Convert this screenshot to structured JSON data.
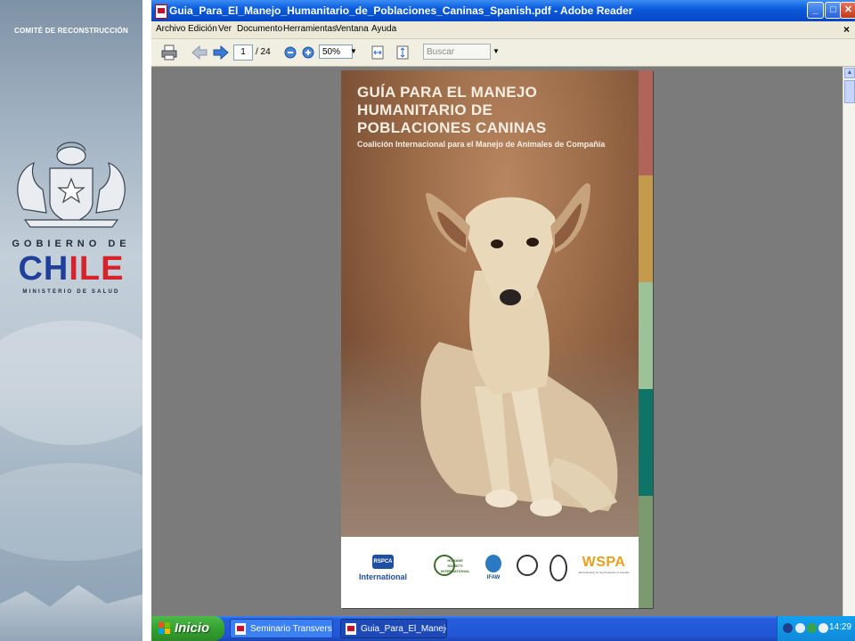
{
  "banner": {
    "committee": "COMITÉ DE RECONSTRUCCIÓN",
    "gobierno": "GOBIERNO DE",
    "chile_part1": "CH",
    "chile_part2": "ILE",
    "ministerio": "MINISTERIO DE SALUD"
  },
  "window": {
    "title": "Guia_Para_El_Manejo_Humanitario_de_Poblaciones_Caninas_Spanish.pdf - Adobe Reader",
    "minimize": "_",
    "maximize": "□",
    "close": "✕",
    "menu": [
      "Archivo",
      "Edición",
      "Ver",
      "Documento",
      "Herramientas",
      "Ventana",
      "Ayuda"
    ],
    "menu_close": "×"
  },
  "toolbar": {
    "current_page": "1",
    "total_pages": "/ 24",
    "zoom": "50%",
    "search_placeholder": "Buscar",
    "dropdown_glyph": "▼"
  },
  "document": {
    "title_line1": "GUÍA PARA EL MANEJO",
    "title_line2": "HUMANITARIO DE",
    "title_line3": "POBLACIONES CANINAS",
    "subtitle": "Coalición Internacional para el Manejo de Animales de Compañía",
    "stripe_colors": [
      "#b0645a",
      "#c49a4c",
      "#9dc198",
      "#0f7468",
      "#7c9a70"
    ],
    "logos": {
      "rspca_badge": "RSPCA",
      "rspca_text": "International",
      "hsi_text": "HUMANE SOCIETY INTERNATIONAL",
      "ifaw_text": "IFAW",
      "wspa_text": "WSPA",
      "wspa_sub": "World Society for the Protection of Animals"
    }
  },
  "taskbar": {
    "start_label": "Inicio",
    "tasks": [
      {
        "label": "Seminario Transversa..."
      },
      {
        "label": "Guia_Para_El_Manejo..."
      }
    ],
    "clock": "14:29"
  }
}
